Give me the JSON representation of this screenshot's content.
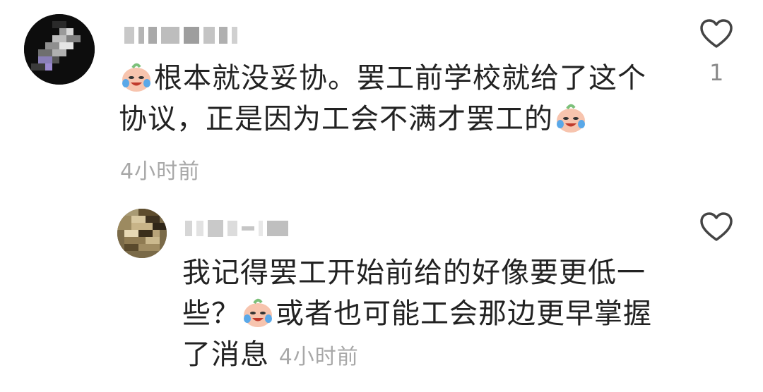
{
  "comment": {
    "text_line1": "根本就没妥协。罢工前学校就给了这个",
    "text_line2_a": "协议，正是因为工会不满才罢工的",
    "time": "4小时前",
    "like_count": "1"
  },
  "reply": {
    "text_line1": "我记得罢工开始前给的好像要更低一",
    "text_line2_a": "些？",
    "text_line2_b": "或者也可能工会那边更早掌握",
    "text_line3": "了消息",
    "time": "4小时前"
  },
  "icons": {
    "like": "heart-outline-icon",
    "emoji": "crying-laughing-peach-emoji"
  }
}
